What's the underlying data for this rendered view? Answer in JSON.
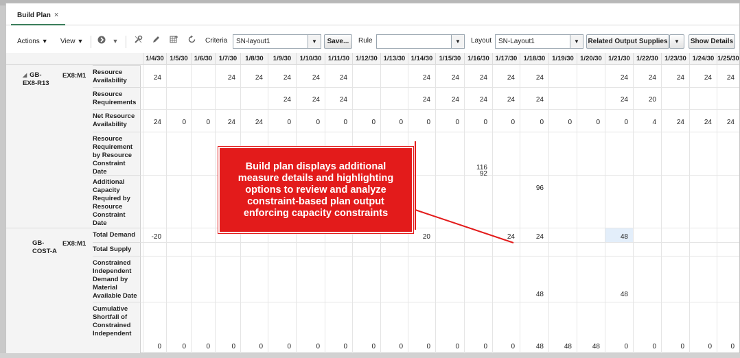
{
  "tab": {
    "label": "Build Plan",
    "close": "×"
  },
  "toolbar": {
    "actions": "Actions",
    "view": "View",
    "criteria_label": "Criteria",
    "criteria_value": "SN-layout1",
    "save": "Save...",
    "rule_label": "Rule",
    "rule_value": "",
    "layout_label": "Layout",
    "layout_value": "SN-Layout1",
    "related_output": "Related Output Supplies",
    "show_details": "Show Details",
    "icons": [
      "add-circle-icon",
      "chevron-down-icon",
      "tools-icon",
      "pencil-icon",
      "grid-icon",
      "refresh-icon"
    ]
  },
  "dates": [
    "1/4/30",
    "1/5/30",
    "1/6/30",
    "1/7/30",
    "1/8/30",
    "1/9/30",
    "1/10/30",
    "1/11/30",
    "1/12/30",
    "1/13/30",
    "1/14/30",
    "1/15/30",
    "1/16/30",
    "1/17/30",
    "1/18/30",
    "1/19/30",
    "1/20/30",
    "1/21/30",
    "1/22/30",
    "1/23/30",
    "1/24/30",
    "1/25/30"
  ],
  "groups": [
    {
      "item": "GB-EX8-R13",
      "expand": "◢",
      "org": "EX8:M1",
      "measures": [
        {
          "name": "Resource Availability",
          "values": [
            "24",
            "",
            "",
            "24",
            "24",
            "24",
            "24",
            "24",
            "",
            "",
            "24",
            "24",
            "24",
            "24",
            "24",
            "",
            "",
            "24",
            "24",
            "24",
            "24",
            "24"
          ]
        },
        {
          "name": "Resource Requirements",
          "values": [
            "",
            "",
            "",
            "",
            "",
            "24",
            "24",
            "24",
            "",
            "",
            "24",
            "24",
            "24",
            "24",
            "24",
            "",
            "",
            "24",
            "20",
            "",
            "",
            ""
          ]
        },
        {
          "name": "Net Resource Availability",
          "values": [
            "24",
            "0",
            "0",
            "24",
            "24",
            "0",
            "0",
            "0",
            "0",
            "0",
            "0",
            "0",
            "0",
            "0",
            "0",
            "0",
            "0",
            "0",
            "4",
            "24",
            "24",
            "24"
          ]
        },
        {
          "name": "Resource Requirement by Resource Constraint Date",
          "values": [
            "",
            "",
            "",
            "",
            "",
            "",
            "",
            "",
            "",
            "",
            "",
            "",
            "116",
            "",
            "",
            "",
            "",
            "",
            "",
            "",
            "",
            ""
          ]
        },
        {
          "name": "Additional Capacity Required by Resource Constraint Date",
          "values": [
            "",
            "",
            "",
            "",
            "",
            "",
            "",
            "",
            "",
            "",
            "",
            "",
            "92",
            "",
            "96",
            "",
            "",
            "",
            "",
            "",
            "",
            ""
          ]
        }
      ]
    },
    {
      "item": "GB-COST-A",
      "org": "EX8:M1",
      "measures": [
        {
          "name": "Total Demand",
          "values": [
            "-20",
            "",
            "",
            "",
            "",
            "",
            "",
            "",
            "",
            "",
            "20",
            "",
            "",
            "24",
            "24",
            "",
            "",
            "48",
            "",
            "",
            "",
            ""
          ]
        },
        {
          "name": "Total Supply",
          "values": [
            "",
            "",
            "",
            "",
            "",
            "",
            "",
            "",
            "",
            "",
            "",
            "",
            "",
            "",
            "",
            "",
            "",
            "",
            "",
            "",
            "",
            ""
          ]
        },
        {
          "name": "Constrained Independent Demand by Material Available Date",
          "values": [
            "",
            "",
            "",
            "",
            "",
            "",
            "",
            "",
            "",
            "",
            "",
            "",
            "",
            "",
            "48",
            "",
            "",
            "48",
            "",
            "",
            "",
            ""
          ]
        },
        {
          "name": "Cumulative Shortfall of Constrained Independent",
          "values": [
            "0",
            "0",
            "0",
            "0",
            "0",
            "0",
            "0",
            "0",
            "0",
            "0",
            "0",
            "0",
            "0",
            "0",
            "48",
            "48",
            "48",
            "0",
            "0",
            "0",
            "0",
            "0"
          ]
        }
      ]
    }
  ],
  "callout": "Build plan displays additional measure details and highlighting options to review and analyze constraint-based plan output enforcing capacity constraints",
  "colors": {
    "callout": "#e31b1b",
    "highlight": "#e3eefa",
    "tab_accent": "#3a7d5a"
  }
}
